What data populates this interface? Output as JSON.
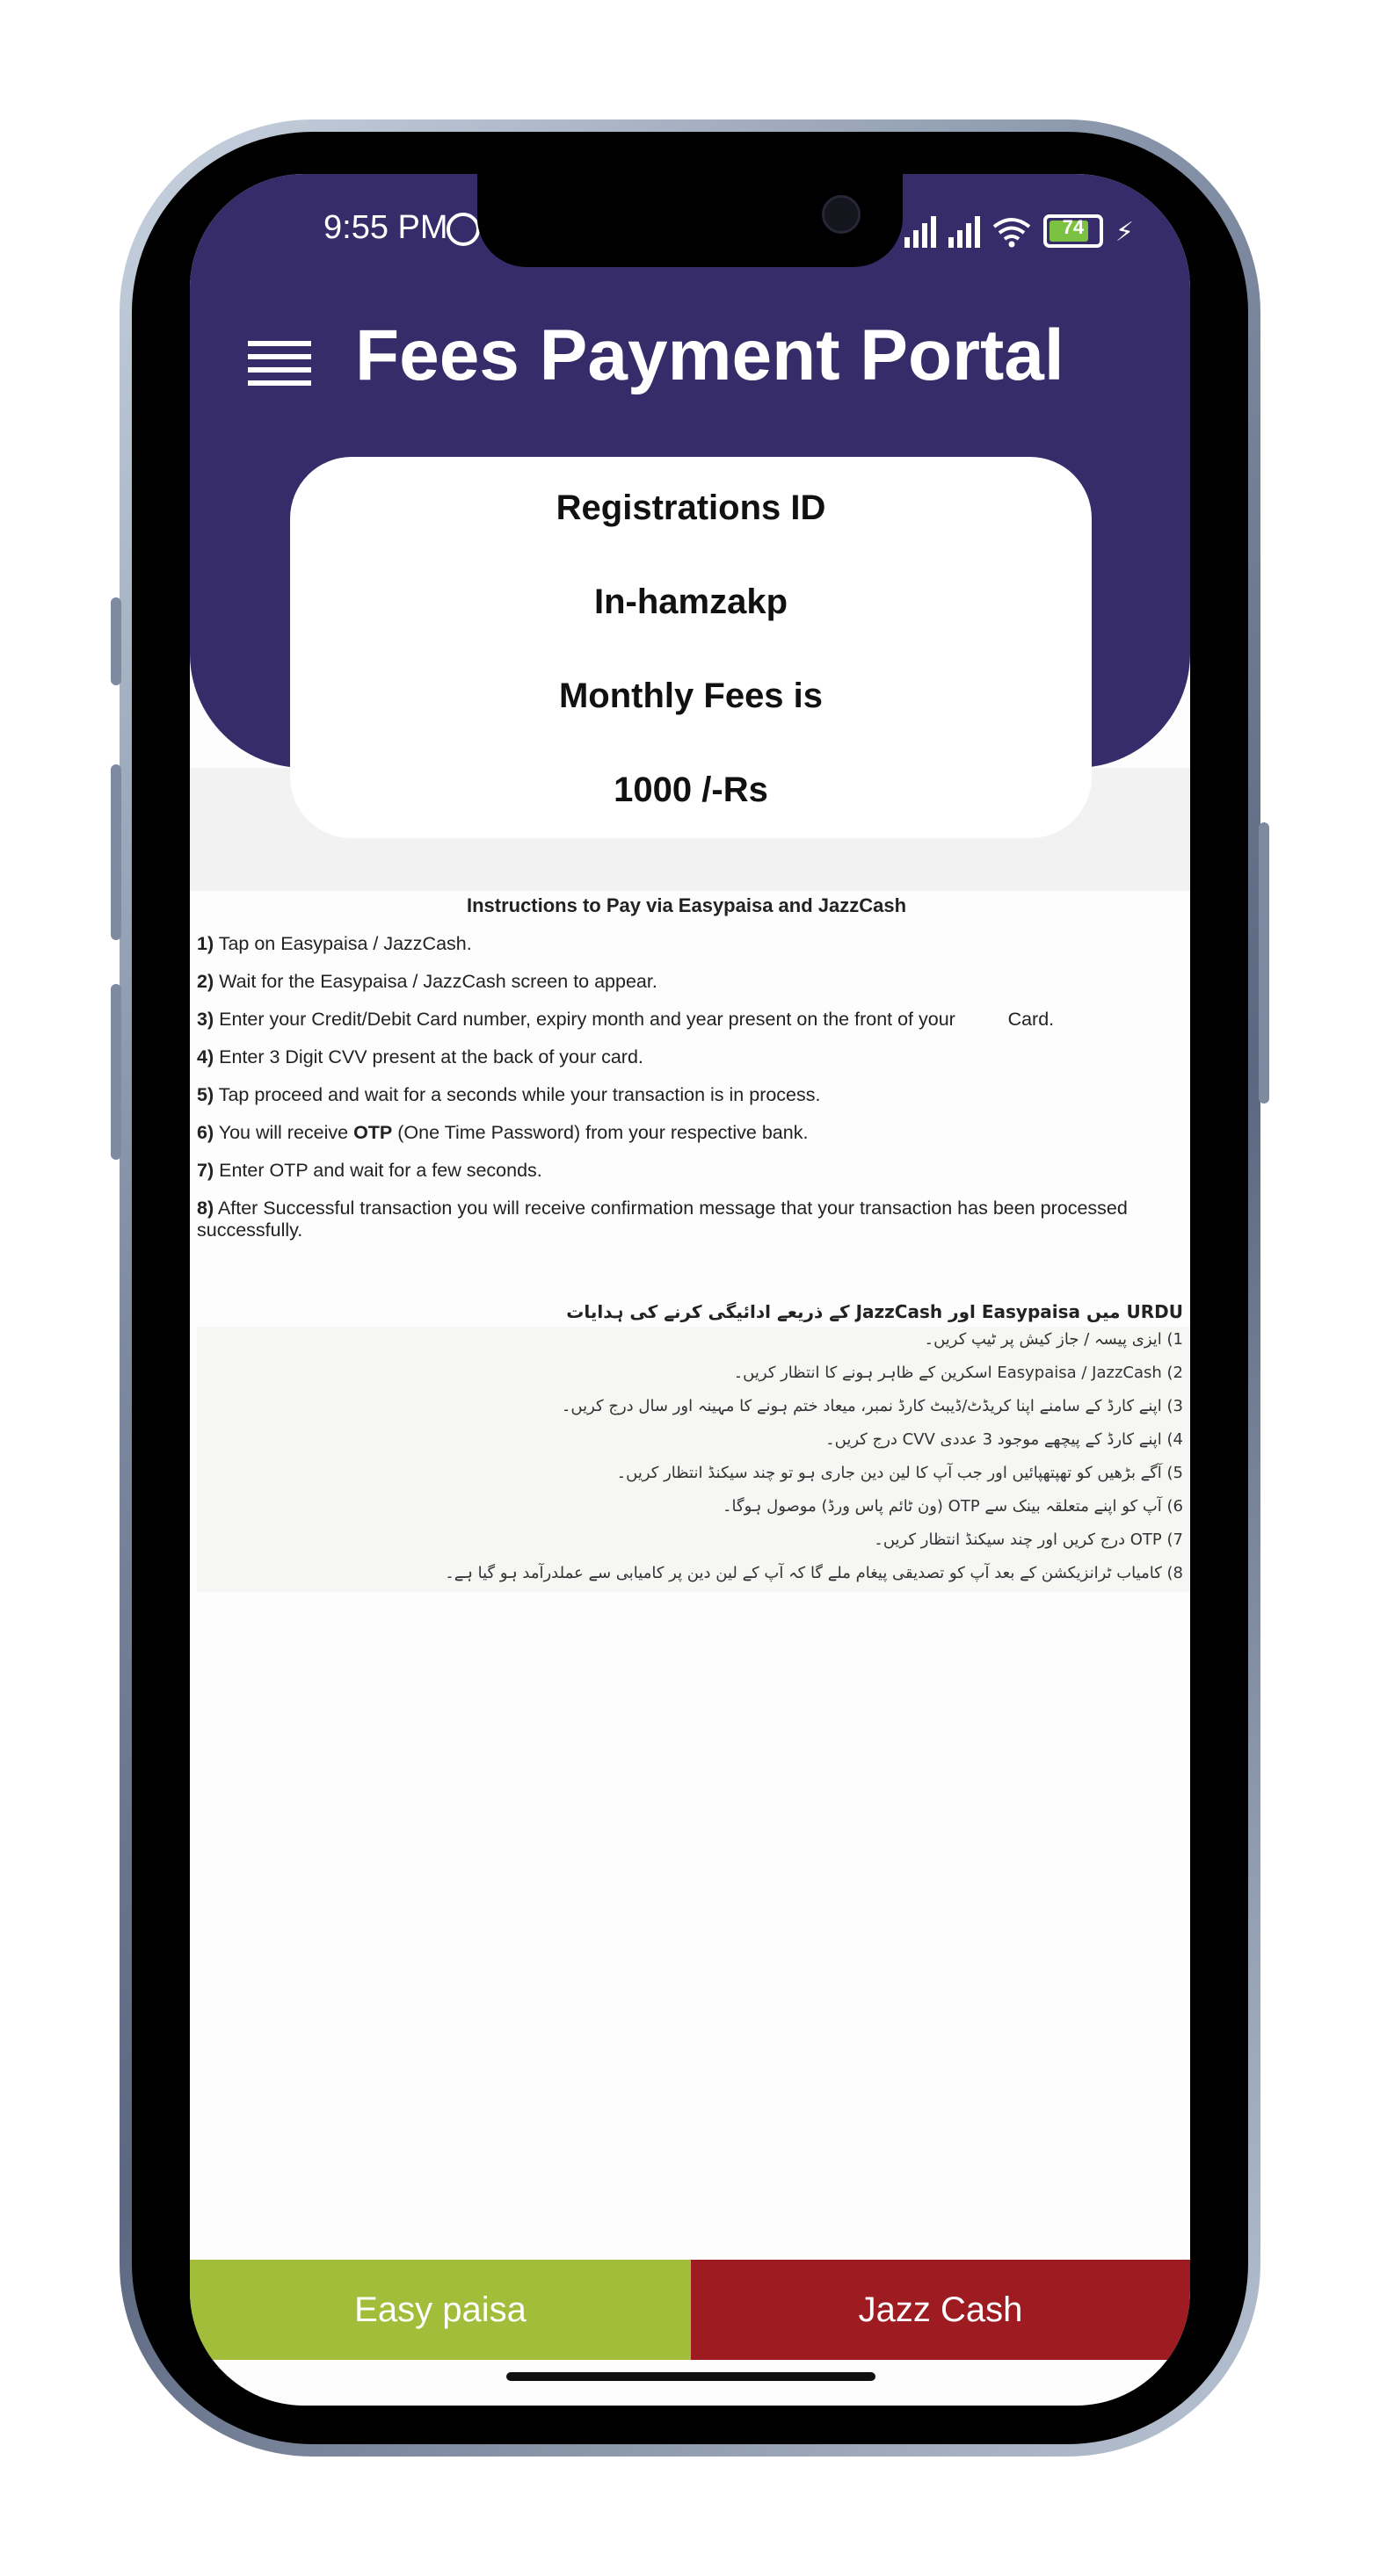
{
  "status_bar": {
    "time": "9:55 PM",
    "battery_level": "74",
    "icons": [
      "whatsapp-icon",
      "signal-icon",
      "signal-icon",
      "wifi-icon",
      "battery-icon",
      "charging-icon"
    ]
  },
  "header": {
    "menu_icon": "hamburger-menu-icon",
    "title": "Fees Payment Portal"
  },
  "info_card": {
    "registration_label": "Registrations ID",
    "registration_id": "In-hamzakp",
    "fees_label": "Monthly Fees  is",
    "fees_amount": "1000 /-Rs"
  },
  "instructions_en": {
    "title": "Instructions to Pay via Easypaisa and JazzCash",
    "items": [
      {
        "num": "1)",
        "text": " Tap on Easypaisa / JazzCash."
      },
      {
        "num": "2)",
        "text": " Wait for the Easypaisa / JazzCash screen to appear."
      },
      {
        "num": "3)",
        "text": " Enter your Credit/Debit Card number, expiry month and year present on the front of your          Card."
      },
      {
        "num": "4)",
        "text": " Enter 3 Digit CVV present at the back of your card."
      },
      {
        "num": "5)",
        "text": " Tap proceed and wait for a seconds while your transaction is in process."
      },
      {
        "num": "6)",
        "text_before": " You will receive ",
        "bold": "OTP",
        "text_after": " (One Time Password) from your respective bank."
      },
      {
        "num": "7)",
        "text": " Enter OTP and wait for a few seconds."
      },
      {
        "num": "8)",
        "text": " After Successful transaction you will receive confirmation message that your transaction has been processed successfully."
      }
    ]
  },
  "instructions_ur": {
    "title": "URDU میں Easypaisa اور JazzCash کے ذریعے ادائیگی کرنے کی ہدایات",
    "items": [
      "1) ایزی پیسہ / جاز کیش پر ٹیپ کریں۔",
      "2) Easypaisa / JazzCash اسکرین کے ظاہر ہونے کا انتظار کریں۔",
      "3) اپنے کارڈ کے سامنے اپنا کریڈٹ/ڈیبٹ کارڈ نمبر، میعاد ختم ہونے کا مہینہ اور سال درج کریں۔",
      "4) اپنے کارڈ کے پیچھے موجود 3 عددی CVV درج کریں۔",
      "5) آگے بڑھیں کو تھپتھپائیں اور جب آپ کا لین دین جاری ہو تو چند سیکنڈ انتظار کریں۔",
      "6) آپ کو اپنے متعلقہ بینک سے OTP (ون ٹائم پاس ورڈ) موصول ہوگا۔",
      "7) OTP درج کریں اور چند سیکنڈ انتظار کریں۔",
      "8) کامیاب ٹرانزیکشن کے بعد آپ کو تصدیقی پیغام ملے گا کہ آپ کے لین دین پر کامیابی سے عملدرآمد ہو گیا ہے۔"
    ]
  },
  "buttons": {
    "easypaisa": "Easy paisa",
    "jazzcash": "Jazz Cash"
  },
  "colors": {
    "header": "#352c69",
    "easypaisa": "#a1bd39",
    "jazzcash": "#9d1b21"
  }
}
